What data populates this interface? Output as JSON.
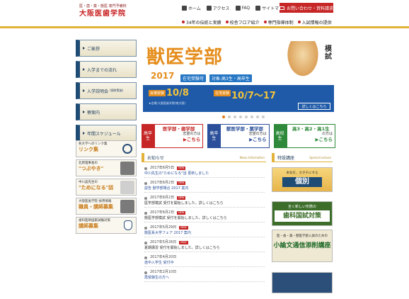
{
  "header": {
    "logo_line1": "医・歯・薬・獣医 専門予備校",
    "logo_line2": "大阪医歯学院",
    "topnav": [
      {
        "label": "ホーム",
        "icon": "home-icon"
      },
      {
        "label": "アクセス",
        "icon": "bus-icon"
      },
      {
        "label": "FAQ",
        "icon": "chat-icon"
      },
      {
        "label": "サイトマップ",
        "icon": "sitemap-icon"
      }
    ],
    "inquiry": "お問い合わせ・資料請求",
    "subnav": [
      "34年の伝統と実績",
      "校舎フロア紹介",
      "専門指導体制",
      "入試情報の提供"
    ]
  },
  "leftnav": {
    "items": [
      {
        "label": "ご挨拶",
        "note": ""
      },
      {
        "label": "入学までの流れ",
        "note": ""
      },
      {
        "label": "入学説明会",
        "note": "(随時実施)"
      },
      {
        "label": "寮案内",
        "note": ""
      },
      {
        "label": "年間スケジュール",
        "note": ""
      }
    ]
  },
  "banners": [
    {
      "small": "各大学へのリンク集",
      "big": "リンク集"
    },
    {
      "small": "北原理事長の",
      "big": "\"つぶやき\""
    },
    {
      "small": "中川晶先生の",
      "big": "\"ためになる\"話"
    },
    {
      "small": "大阪医歯学院 採用情報",
      "big": "職員・講師募集"
    },
    {
      "small": "歯科医師国家試験対策",
      "big": "講師募集"
    }
  ],
  "hero": {
    "title": "獣医学部",
    "vertical": "模試",
    "year": "2017",
    "pill1": "在宅受験可",
    "pill2": "対象:高3生・高卒生",
    "label_a": "会場受験",
    "date_a": "10/8",
    "date_a_day": "日",
    "label_b": "在宅受験",
    "date_b": "10/7〜17",
    "date_b_day": "火",
    "location": "★会場:大阪医歯学院(南大阪)",
    "more": "詳しくはこちら",
    "dots": 8,
    "active_dot": 0
  },
  "categories": [
    {
      "tag": "高卒生",
      "title": "医学部・歯学部",
      "want": "志望の方は",
      "go": "▶こちら",
      "color": "#c62626"
    },
    {
      "tag": "高卒生",
      "title": "獣医学部・薬学部",
      "want": "志望の方は",
      "go": "▶こちら",
      "color": "#2b4f9a"
    },
    {
      "tag": "高校生",
      "title": "高3・高2・高1生",
      "want": "の方は",
      "go": "▶こちら",
      "color": "#2e8a3a"
    }
  ],
  "news": {
    "title": "お知らせ",
    "title_en": "News Information",
    "items": [
      {
        "date": "2017年6月5日",
        "text": "中川先生の\"ためになる\"話 更新しました",
        "link": true
      },
      {
        "date": "2017年6月2日",
        "text": "説告 獣学部場合 2017 案内",
        "link": true
      },
      {
        "date": "2017年6月2日",
        "text": "医学部模試 受付を開始しました。詳しくはこちら",
        "link": false
      },
      {
        "date": "2017年6月2日",
        "text": "獣医学部模試 受付を開始しました。詳しくはこちら",
        "link": false
      },
      {
        "date": "2017年5月29日",
        "text": "獣医系大学フェア 2017 案内",
        "link": true
      },
      {
        "date": "2017年5月26日",
        "text": "夏期講習 受付を開始しました。詳しくはこちら",
        "link": false
      },
      {
        "date": "2017年4月20日",
        "text": "途中入学生 受付中",
        "link": true
      },
      {
        "date": "2017年2月10日",
        "text": "再受験生の方へ",
        "link": true
      }
    ]
  },
  "features": {
    "title": "特設講座",
    "title_en": "Special Lecture",
    "f1_small": "本気を、カタチにする",
    "f1_big": "個別",
    "f2_small": "全く新しい形態の",
    "f2_big": "歯科国試対策",
    "f3_small": "医・歯・薬・獣医学部入試のための",
    "f3_big": "小論文通信添削講座"
  }
}
